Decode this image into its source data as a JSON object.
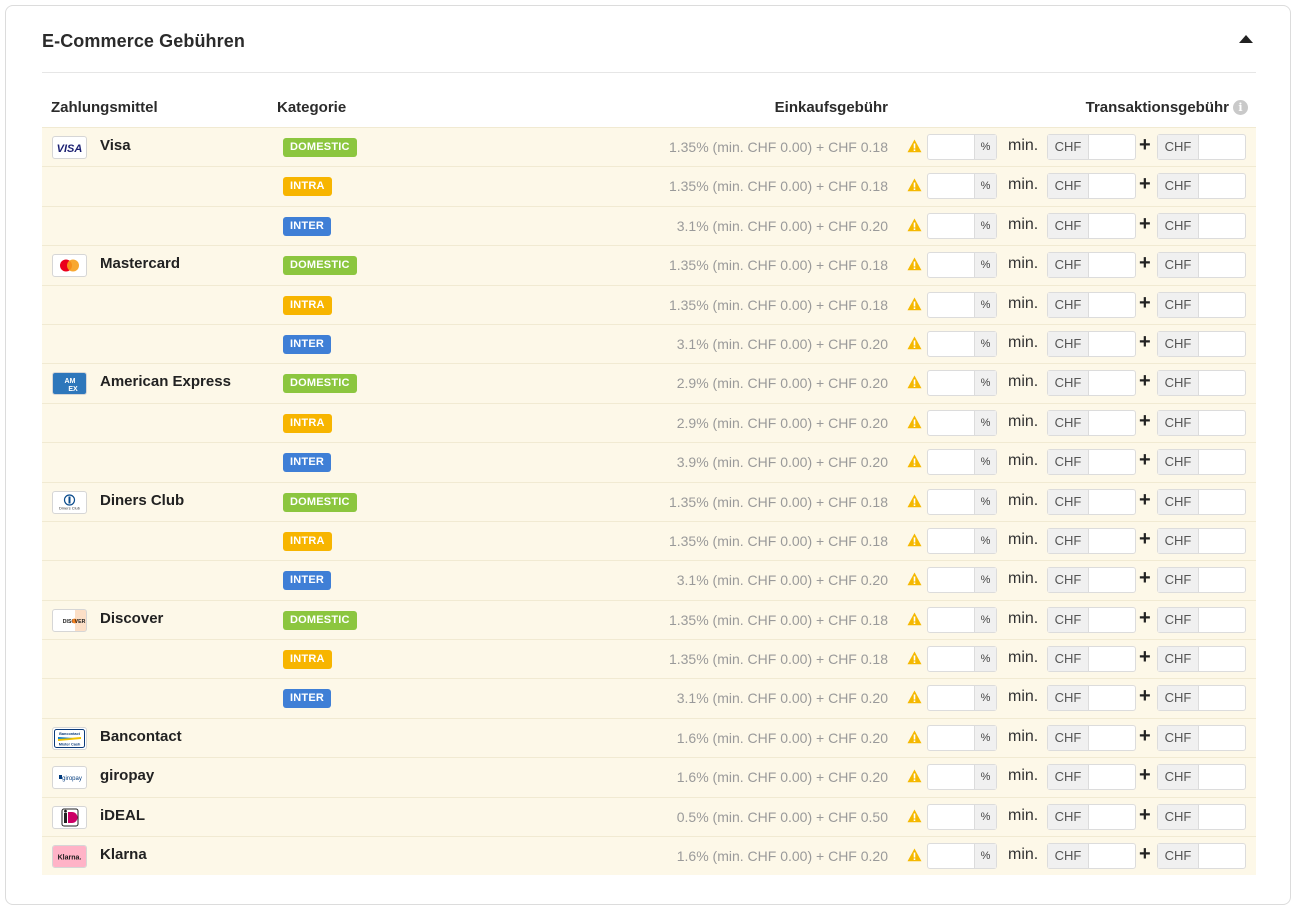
{
  "panel": {
    "title": "E-Commerce Gebühren",
    "collapse_icon": "caret-up-icon"
  },
  "columns": {
    "payment_method": "Zahlungsmittel",
    "category": "Kategorie",
    "purchase_fee": "Einkaufsgebühr",
    "transaction_fee": "Transaktionsgebühr",
    "info_icon": "info-icon"
  },
  "labels": {
    "percent": "%",
    "min": "min.",
    "currency": "CHF",
    "plus": "+"
  },
  "colors": {
    "domestic": "#8cc63f",
    "intra": "#f7b500",
    "inter": "#3f7fd6",
    "row_background": "#fdf8e8",
    "warning": "#f5b800"
  },
  "rows": [
    {
      "method": "Visa",
      "logo": "visa-logo",
      "category": "DOMESTIC",
      "fee": "1.35% (min. CHF 0.00) + CHF 0.18"
    },
    {
      "method": "",
      "logo": "",
      "category": "INTRA",
      "fee": "1.35% (min. CHF 0.00) + CHF 0.18"
    },
    {
      "method": "",
      "logo": "",
      "category": "INTER",
      "fee": "3.1% (min. CHF 0.00) + CHF 0.20"
    },
    {
      "method": "Mastercard",
      "logo": "mastercard-logo",
      "category": "DOMESTIC",
      "fee": "1.35% (min. CHF 0.00) + CHF 0.18"
    },
    {
      "method": "",
      "logo": "",
      "category": "INTRA",
      "fee": "1.35% (min. CHF 0.00) + CHF 0.18"
    },
    {
      "method": "",
      "logo": "",
      "category": "INTER",
      "fee": "3.1% (min. CHF 0.00) + CHF 0.20"
    },
    {
      "method": "American Express",
      "logo": "amex-logo",
      "category": "DOMESTIC",
      "fee": "2.9% (min. CHF 0.00) + CHF 0.20"
    },
    {
      "method": "",
      "logo": "",
      "category": "INTRA",
      "fee": "2.9% (min. CHF 0.00) + CHF 0.20"
    },
    {
      "method": "",
      "logo": "",
      "category": "INTER",
      "fee": "3.9% (min. CHF 0.00) + CHF 0.20"
    },
    {
      "method": "Diners Club",
      "logo": "diners-logo",
      "category": "DOMESTIC",
      "fee": "1.35% (min. CHF 0.00) + CHF 0.18"
    },
    {
      "method": "",
      "logo": "",
      "category": "INTRA",
      "fee": "1.35% (min. CHF 0.00) + CHF 0.18"
    },
    {
      "method": "",
      "logo": "",
      "category": "INTER",
      "fee": "3.1% (min. CHF 0.00) + CHF 0.20"
    },
    {
      "method": "Discover",
      "logo": "discover-logo",
      "category": "DOMESTIC",
      "fee": "1.35% (min. CHF 0.00) + CHF 0.18"
    },
    {
      "method": "",
      "logo": "",
      "category": "INTRA",
      "fee": "1.35% (min. CHF 0.00) + CHF 0.18"
    },
    {
      "method": "",
      "logo": "",
      "category": "INTER",
      "fee": "3.1% (min. CHF 0.00) + CHF 0.20"
    },
    {
      "method": "Bancontact",
      "logo": "bancontact-logo",
      "category": "",
      "fee": "1.6% (min. CHF 0.00) + CHF 0.20"
    },
    {
      "method": "giropay",
      "logo": "giropay-logo",
      "category": "",
      "fee": "1.6% (min. CHF 0.00) + CHF 0.20"
    },
    {
      "method": "iDEAL",
      "logo": "ideal-logo",
      "category": "",
      "fee": "0.5% (min. CHF 0.00) + CHF 0.50"
    },
    {
      "method": "Klarna",
      "logo": "klarna-logo",
      "category": "",
      "fee": "1.6% (min. CHF 0.00) + CHF 0.20"
    }
  ],
  "logo_text": {
    "visa": "VISA",
    "amex": "AM EX",
    "diners": "Diners Club",
    "discover": "DISCOVER",
    "bancontact_top": "Bancontact",
    "bancontact_bottom": "Mister Cash",
    "giropay": "giropay",
    "ideal": "iD",
    "klarna": "Klarna."
  }
}
